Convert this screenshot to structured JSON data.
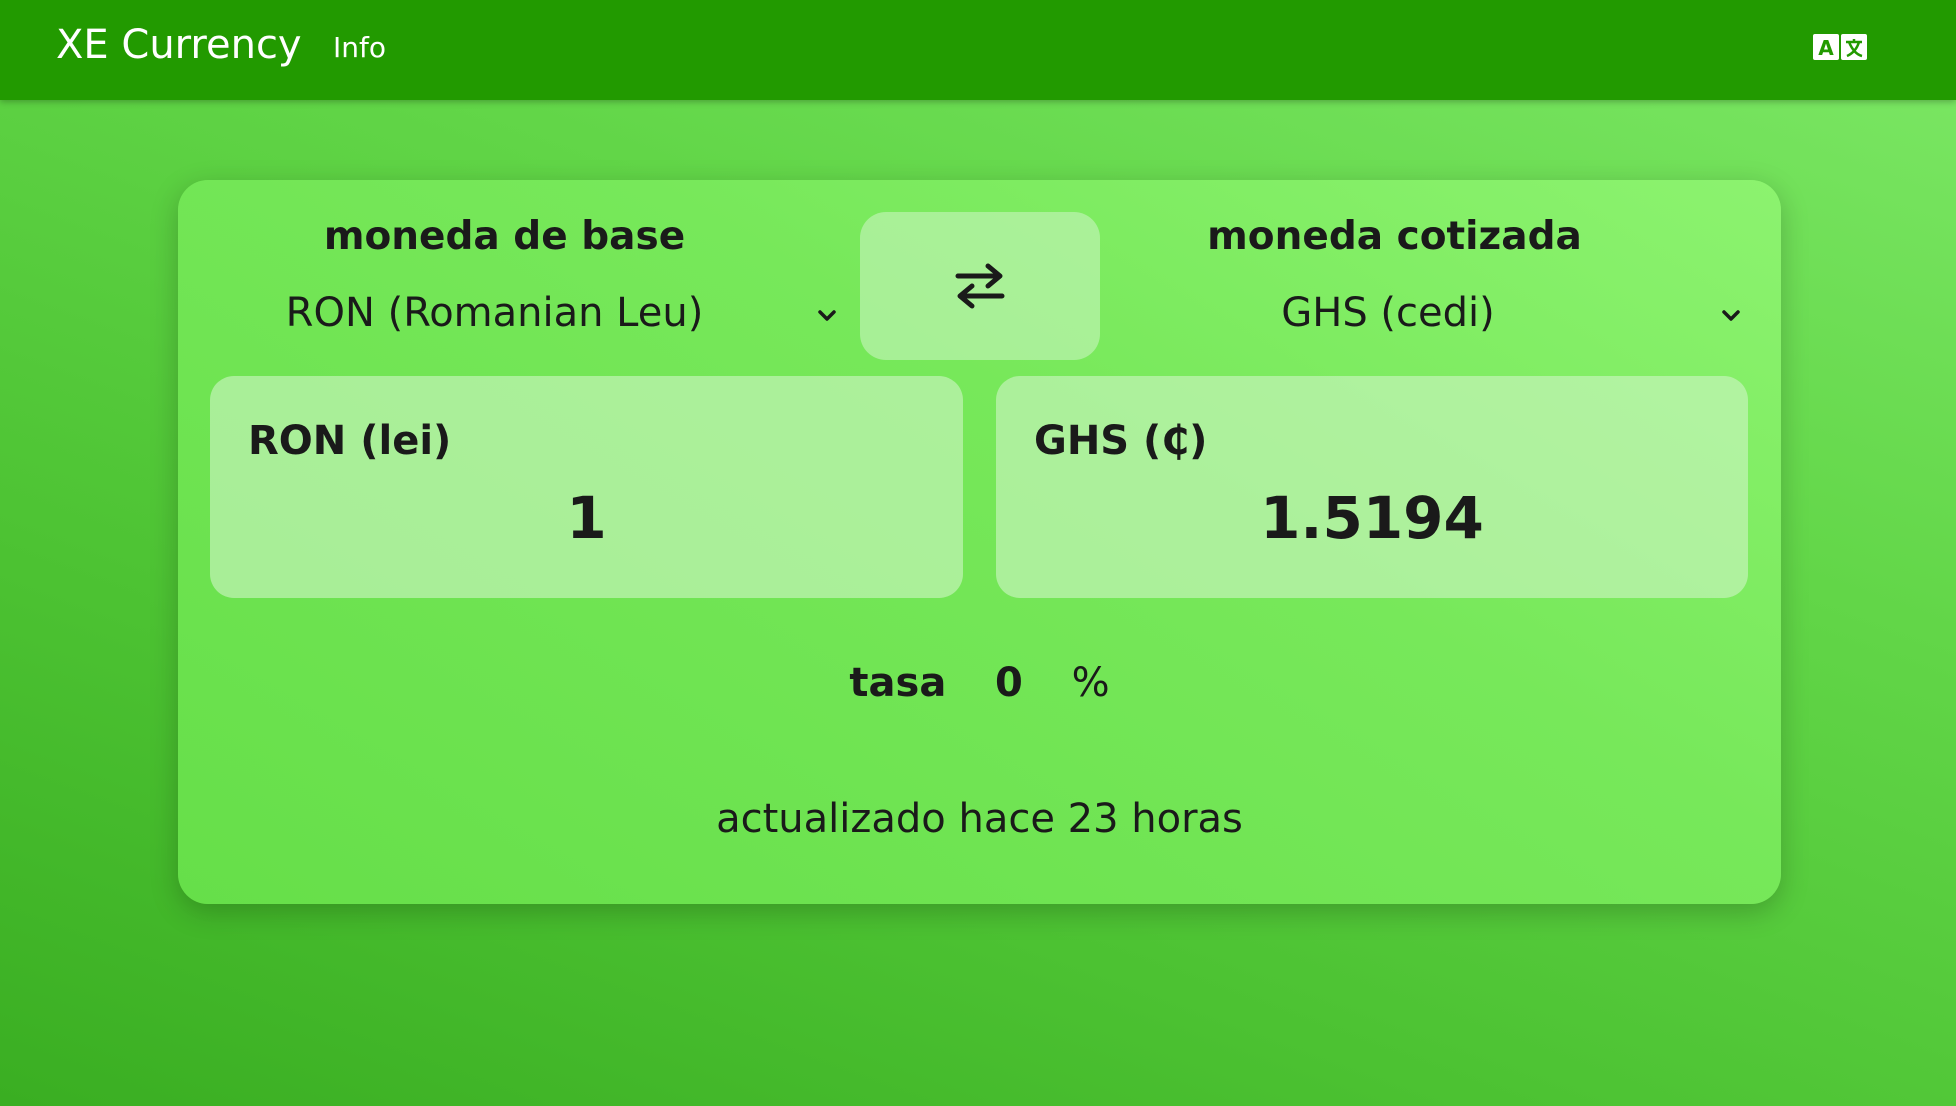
{
  "appbar": {
    "title": "XE Currency",
    "nav_info": "Info",
    "translate_icon": "translate-icon"
  },
  "converter": {
    "base": {
      "label": "moneda de base",
      "selected": "RON (Romanian Leu)",
      "amount_label": "RON (lei)",
      "amount": "1"
    },
    "quote": {
      "label": "moneda cotizada",
      "selected": "GHS (cedi)",
      "amount_label": "GHS (₵)",
      "amount": "1.5194"
    },
    "swap_icon": "swap-arrows-icon",
    "fee": {
      "label": "tasa",
      "value": "0",
      "unit": "%"
    },
    "updated": "actualizado hace 23 horas"
  },
  "colors": {
    "appbar": "#229a00",
    "accent": "#229a00",
    "card": "#77e85a",
    "background": "#4cc232"
  }
}
